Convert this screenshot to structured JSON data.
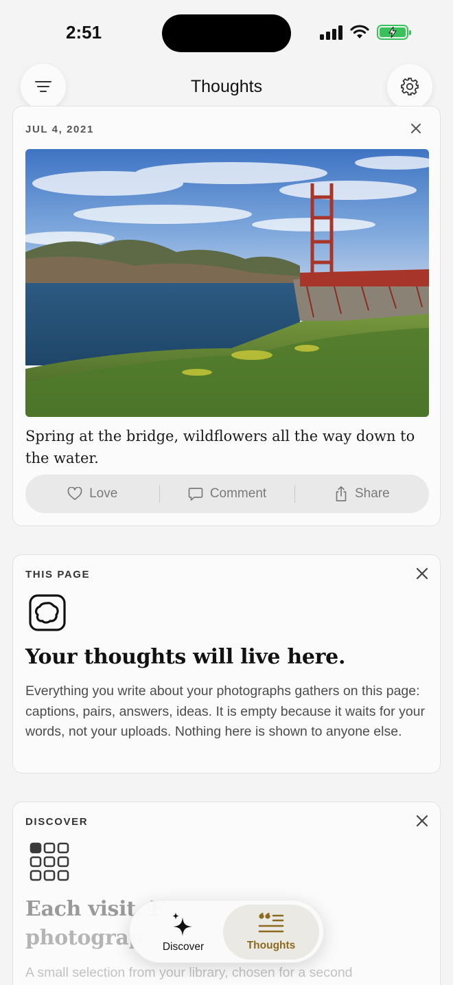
{
  "status_bar": {
    "time": "2:51"
  },
  "header": {
    "title": "Thoughts"
  },
  "entry_card": {
    "date": "JUL 4, 2021",
    "caption": "Spring at the bridge, wildflowers all the way down to the water.",
    "actions": {
      "love": "Love",
      "comment": "Comment",
      "share": "Share"
    }
  },
  "this_page_card": {
    "label": "THIS PAGE",
    "headline": "Your thoughts will live here.",
    "body": "Everything you write about your photographs gathers on this page: captions, pairs, answers, ideas. It is empty because it waits for your words, not your uploads. Nothing here is shown to anyone else."
  },
  "discover_card": {
    "label": "DISCOVER",
    "headline_line1": "Each visit, F",
    "headline_line2": "photograp",
    "body": "A small selection from your library, chosen for a second"
  },
  "bottom_nav": {
    "discover": "Discover",
    "thoughts": "Thoughts"
  },
  "colors": {
    "accent": "#8a6a1e",
    "battery": "#39c25a",
    "muted_text": "#7a7a7a"
  },
  "icons": [
    "filter-menu-icon",
    "gear-icon",
    "close-icon",
    "heart-icon",
    "comment-icon",
    "share-icon",
    "blob-square-icon",
    "grid-icon",
    "sparkle-icon",
    "quote-lines-icon"
  ]
}
